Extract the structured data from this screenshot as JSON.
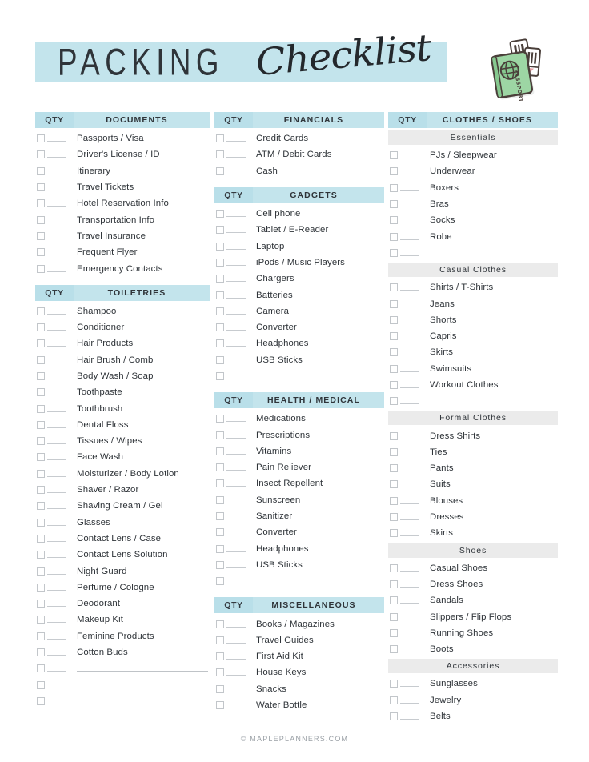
{
  "header": {
    "title_main": "PACKING",
    "title_script": "Checklist",
    "icon": "passport-tickets-icon"
  },
  "labels": {
    "qty": "QTY"
  },
  "colors": {
    "band": "#c3e4ec",
    "band_qty": "#b9dfe9",
    "subsection": "#ebebeb",
    "text": "#2f3439",
    "rule": "#c7cbcf",
    "passport_green": "#9dd6a4"
  },
  "columns": [
    {
      "name": "column-left",
      "sections": [
        {
          "title": "DOCUMENTS",
          "qty_label": "QTY",
          "items": [
            "Passports / Visa",
            "Driver's License / ID",
            "Itinerary",
            "Travel Tickets",
            "Hotel Reservation Info",
            "Transportation Info",
            "Travel Insurance",
            "Frequent Flyer",
            "Emergency Contacts"
          ],
          "blank_rows": 0,
          "blank_write_rows": 0
        },
        {
          "title": "TOILETRIES",
          "qty_label": "QTY",
          "items": [
            "Shampoo",
            "Conditioner",
            "Hair Products",
            "Hair Brush / Comb",
            "Body Wash / Soap",
            "Toothpaste",
            "Toothbrush",
            "Dental Floss",
            "Tissues / Wipes",
            "Face Wash",
            "Moisturizer / Body Lotion",
            "Shaver / Razor",
            "Shaving Cream / Gel",
            "Glasses",
            "Contact Lens / Case",
            "Contact Lens Solution",
            "Night Guard",
            "Perfume / Cologne",
            "Deodorant",
            "Makeup Kit",
            "Feminine Products",
            "Cotton Buds"
          ],
          "blank_rows": 0,
          "blank_write_rows": 3
        }
      ]
    },
    {
      "name": "column-middle",
      "sections": [
        {
          "title": "FINANCIALS",
          "qty_label": "QTY",
          "items": [
            "Credit Cards",
            "ATM / Debit Cards",
            "Cash"
          ],
          "blank_rows": 0,
          "blank_write_rows": 0
        },
        {
          "title": "GADGETS",
          "qty_label": "QTY",
          "items": [
            "Cell phone",
            "Tablet / E-Reader",
            "Laptop",
            "iPods / Music Players",
            "Chargers",
            "Batteries",
            "Camera",
            "Converter",
            "Headphones",
            "USB Sticks"
          ],
          "blank_rows": 1,
          "blank_write_rows": 0
        },
        {
          "title": "HEALTH / MEDICAL",
          "qty_label": "QTY",
          "items": [
            "Medications",
            "Prescriptions",
            "Vitamins",
            "Pain Reliever",
            "Insect Repellent",
            "Sunscreen",
            "Sanitizer",
            "Converter",
            "Headphones",
            "USB Sticks"
          ],
          "blank_rows": 1,
          "blank_write_rows": 0
        },
        {
          "title": "MISCELLANEOUS",
          "qty_label": "QTY",
          "items": [
            "Books / Magazines",
            "Travel Guides",
            "First Aid Kit",
            "House Keys",
            "Snacks",
            "Water Bottle"
          ],
          "blank_rows": 0,
          "blank_write_rows": 0
        }
      ]
    },
    {
      "name": "column-right",
      "sections": [
        {
          "title": "CLOTHES / SHOES",
          "qty_label": "QTY",
          "subsections": [
            {
              "title": "Essentials",
              "items": [
                "PJs / Sleepwear",
                "Underwear",
                "Boxers",
                "Bras",
                "Socks",
                "Robe"
              ],
              "blank_rows": 1
            },
            {
              "title": "Casual Clothes",
              "items": [
                "Shirts / T-Shirts",
                "Jeans",
                "Shorts",
                "Capris",
                "Skirts",
                "Swimsuits",
                "Workout Clothes"
              ],
              "blank_rows": 1
            },
            {
              "title": "Formal Clothes",
              "items": [
                "Dress Shirts",
                "Ties",
                "Pants",
                "Suits",
                "Blouses",
                "Dresses",
                "Skirts"
              ],
              "blank_rows": 0
            },
            {
              "title": "Shoes",
              "items": [
                "Casual Shoes",
                "Dress Shoes",
                "Sandals",
                "Slippers / Flip Flops",
                "Running Shoes",
                "Boots"
              ],
              "blank_rows": 0
            },
            {
              "title": "Accessories",
              "items": [
                "Sunglasses",
                "Jewelry",
                "Belts"
              ],
              "blank_rows": 0
            }
          ]
        }
      ]
    }
  ],
  "footer": {
    "copyright": "© MAPLEPLANNERS.COM"
  }
}
